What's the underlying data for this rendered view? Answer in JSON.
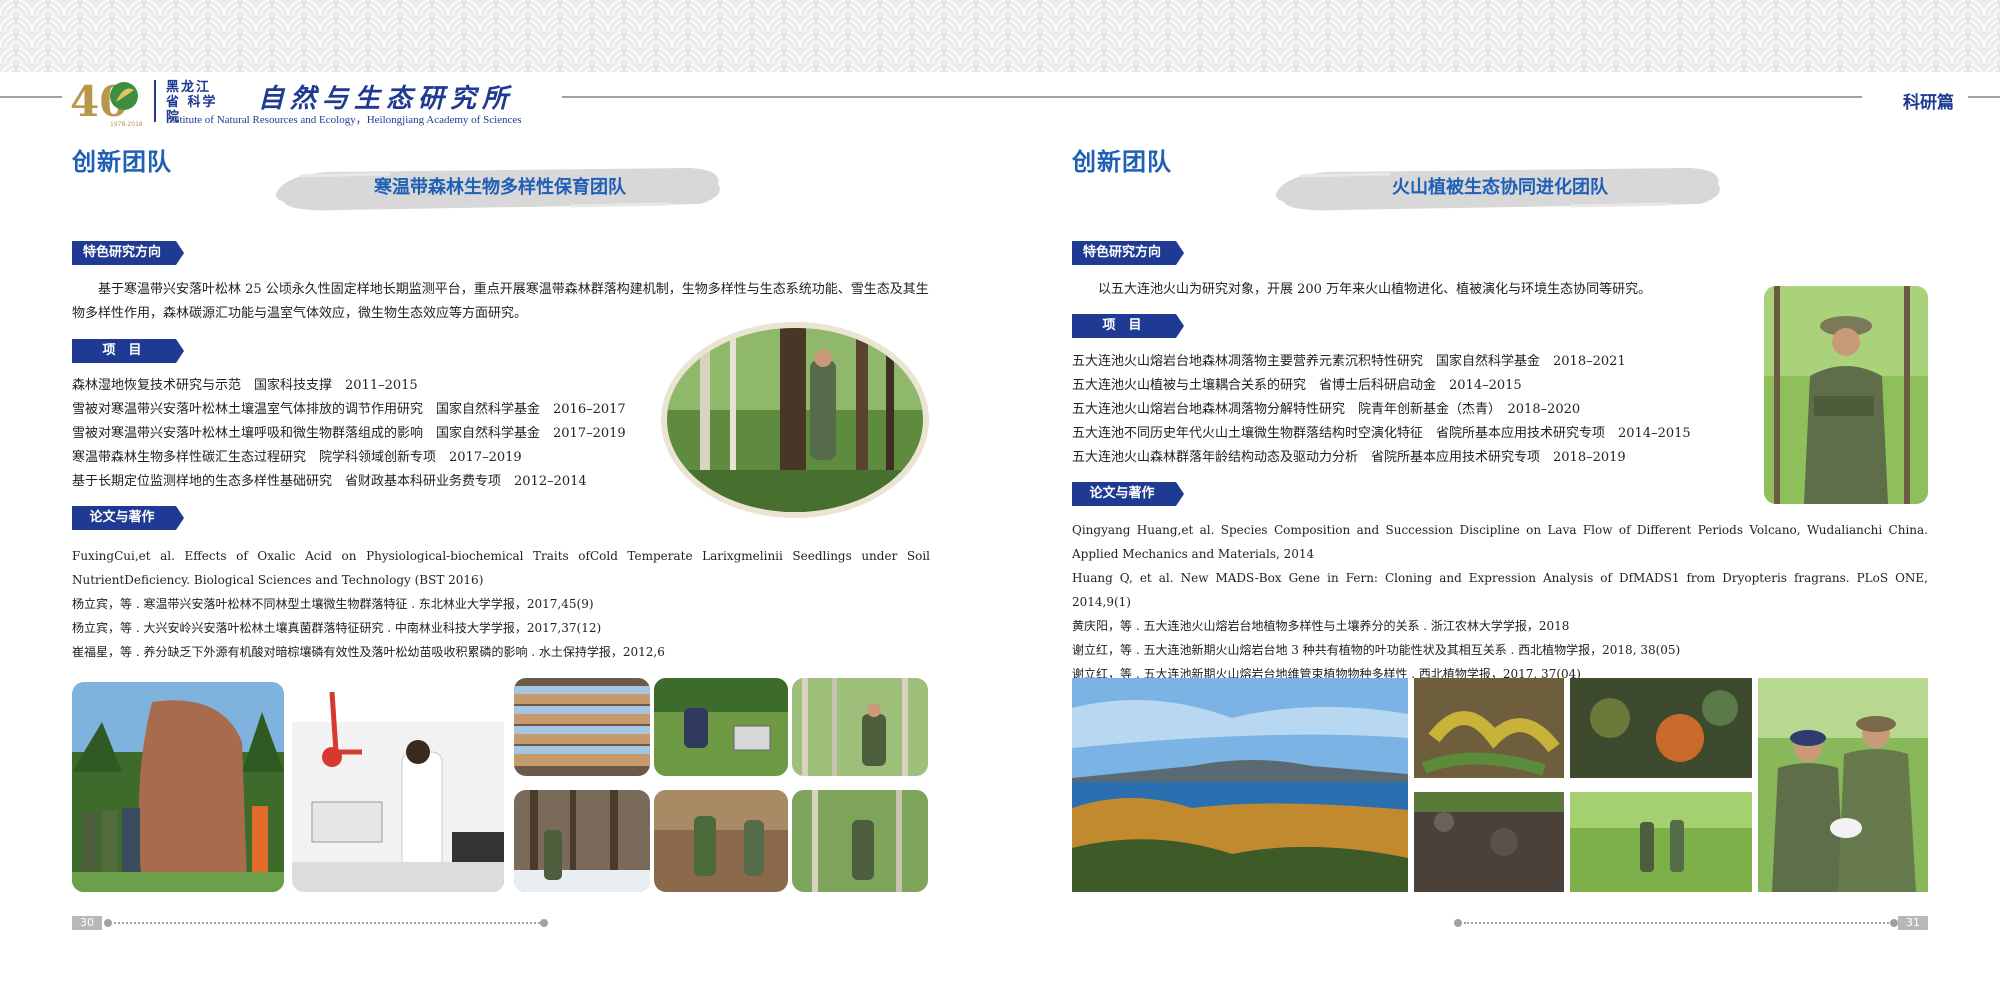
{
  "header": {
    "org_cn_small": "黑龙江省 科学院",
    "org_cn_big": "自然与生态研究所",
    "org_en": "Institute of Natural Resources and Ecology，Heilongjiang Academy of Sciences",
    "logo_number": "40",
    "logo_years": "1978-2018",
    "section_tag": "科研篇"
  },
  "left": {
    "page_title": "创新团队",
    "team_name": "寒温带森林生物多样性保育团队",
    "research_label": "特色研究方向",
    "research_text": "基于寒温带兴安落叶松林 25 公顷永久性固定样地长期监测平台，重点开展寒温带森林群落构建机制，生物多样性与生态系统功能、雪生态及其生物多样性作用，森林碳源汇功能与温室气体效应，微生物生态效应等方面研究。",
    "projects_label": "项　目",
    "projects": [
      "森林湿地恢复技术研究与示范　国家科技支撑　2011–2015",
      "雪被对寒温带兴安落叶松林土壤温室气体排放的调节作用研究　国家自然科学基金　2016–2017",
      "雪被对寒温带兴安落叶松林土壤呼吸和微生物群落组成的影响　国家自然科学基金　2017–2019",
      "寒温带森林生物多样性碳汇生态过程研究　院学科领域创新专项　2017–2019",
      "基于长期定位监测样地的生态多样性基础研究　省财政基本科研业务费专项　2012–2014"
    ],
    "pubs_label": "论文与著作",
    "pubs": [
      "FuxingCui,et al. Effects of Oxalic Acid on Physiological-biochemical Traits ofCold Temperate Larixgmelinii Seedlings under Soil NutrientDeficiency. Biological Sciences and Technology (BST 2016)",
      "杨立宾，等 . 寒温带兴安落叶松林不同林型土壤微生物群落特征 . 东北林业大学学报，2017,45(9)",
      "杨立宾，等 . 大兴安岭兴安落叶松林土壤真菌群落特征研究 . 中南林业科技大学学报，2017,37(12)",
      "崔福星，等 . 养分缺乏下外源有机酸对暗棕壤磷有效性及落叶松幼苗吸收积累磷的影响 . 水土保持学报，2012,6"
    ],
    "page_number": "30"
  },
  "right": {
    "page_title": "创新团队",
    "team_name": "火山植被生态协同进化团队",
    "research_label": "特色研究方向",
    "research_text": "以五大连池火山为研究对象，开展 200 万年来火山植物进化、植被演化与环境生态协同等研究。",
    "projects_label": "项　目",
    "projects": [
      "五大连池火山熔岩台地森林凋落物主要营养元素沉积特性研究　国家自然科学基金　2018–2021",
      "五大连池火山植被与土壤耦合关系的研究　省博士后科研启动金　2014–2015",
      "五大连池火山熔岩台地森林凋落物分解特性研究　院青年创新基金（杰青）　2018–2020",
      "五大连池不同历史年代火山土壤微生物群落结构时空演化特征　省院所基本应用技术研究专项　2014–2015",
      "五大连池火山森林群落年龄结构动态及驱动力分析　省院所基本应用技术研究专项　2018–2019"
    ],
    "pubs_label": "论文与著作",
    "pubs": [
      "Qingyang Huang,et al. Species Composition and Succession Discipline on Lava Flow of Different Periods Volcano, Wudalianchi China. Applied Mechanics and Materials, 2014",
      "Huang Q, et al. New MADS-Box Gene in Fern: Cloning and Expression Analysis of DfMADS1 from Dryopteris fragrans. PLoS ONE, 2014,9(1)",
      "黄庆阳，等 . 五大连池火山熔岩台地植物多样性与土壤养分的关系 . 浙江农林大学学报，2018",
      "谢立红，等 . 五大连池新期火山熔岩台地 3 种共有植物的叶功能性状及其相互关系 . 西北植物学报，2018, 38(05)",
      "谢立红，等 . 五大连池新期火山熔岩台地维管束植物物种多样性 . 西北植物学报，2017, 37(04)"
    ],
    "page_number": "31"
  },
  "colors": {
    "title_blue": "#1f5fb5",
    "ribbon_navy": "#1f3a93",
    "brush_gray": "#d8d8d8",
    "header_wave_bg": "#ebebeb"
  }
}
